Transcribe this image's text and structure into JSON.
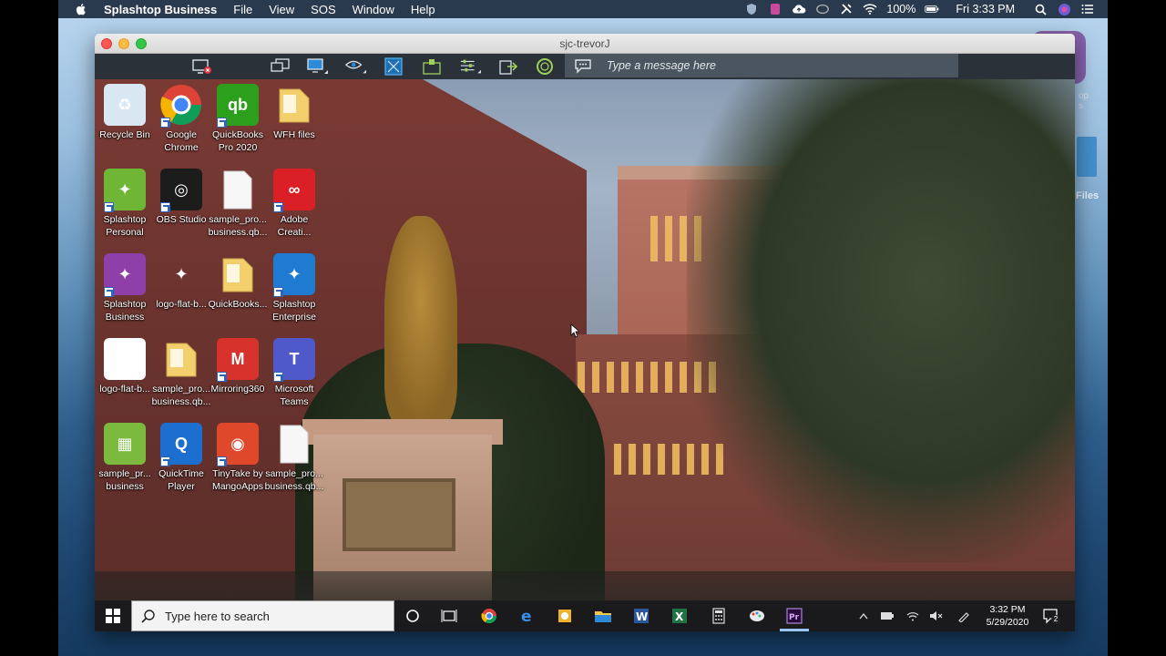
{
  "mac_menubar": {
    "app_name": "Splashtop Business",
    "menus": [
      "File",
      "View",
      "SOS",
      "Window",
      "Help"
    ],
    "battery": "100%",
    "datetime": "Fri 3:33 PM"
  },
  "mac_background": {
    "dock_label_1": "op",
    "dock_label_2": "s",
    "files_label": "Files"
  },
  "window": {
    "title": "sjc-trevorJ",
    "message_placeholder": "Type a message here"
  },
  "desktop_icons": [
    {
      "label1": "Recycle Bin",
      "label2": "",
      "color": "#d8e7f2",
      "glyph": "♻",
      "shortcut": false
    },
    {
      "label1": "Google",
      "label2": "Chrome",
      "color": "#ffffff",
      "glyph": "",
      "shortcut": true
    },
    {
      "label1": "QuickBooks",
      "label2": "Pro 2020",
      "color": "#2ca01c",
      "glyph": "qb",
      "shortcut": true
    },
    {
      "label1": "WFH files",
      "label2": "",
      "color": "#f3d06b",
      "glyph": "",
      "shortcut": false
    },
    {
      "label1": "Splashtop",
      "label2": "Personal",
      "color": "#6fb536",
      "glyph": "✦",
      "shortcut": true
    },
    {
      "label1": "OBS Studio",
      "label2": "",
      "color": "#1c1c1c",
      "glyph": "◎",
      "shortcut": true
    },
    {
      "label1": "sample_pro...",
      "label2": "business.qb...",
      "color": "#f5f5f5",
      "glyph": "",
      "shortcut": false
    },
    {
      "label1": "Adobe",
      "label2": "Creati...",
      "color": "#da1f26",
      "glyph": "∞",
      "shortcut": true
    },
    {
      "label1": "Splashtop",
      "label2": "Business",
      "color": "#8e3fa8",
      "glyph": "✦",
      "shortcut": true
    },
    {
      "label1": "logo-flat-b...",
      "label2": "",
      "color": "transparent",
      "glyph": "✦",
      "shortcut": false
    },
    {
      "label1": "QuickBooks...",
      "label2": "",
      "color": "#f3d06b",
      "glyph": "",
      "shortcut": false
    },
    {
      "label1": "Splashtop",
      "label2": "Enterprise",
      "color": "#1f7bd1",
      "glyph": "✦",
      "shortcut": true
    },
    {
      "label1": "logo-flat-b...",
      "label2": "",
      "color": "#ffffff",
      "glyph": "✦",
      "shortcut": false
    },
    {
      "label1": "sample_pro...",
      "label2": "business.qb...",
      "color": "#f3d06b",
      "glyph": "",
      "shortcut": false
    },
    {
      "label1": "Mirroring360",
      "label2": "",
      "color": "#d8322d",
      "glyph": "M",
      "shortcut": true
    },
    {
      "label1": "Microsoft",
      "label2": "Teams",
      "color": "#5059c9",
      "glyph": "T",
      "shortcut": true
    },
    {
      "label1": "sample_pr...",
      "label2": "business",
      "color": "#7cb93f",
      "glyph": "▦",
      "shortcut": false
    },
    {
      "label1": "QuickTime",
      "label2": "Player",
      "color": "#1d6fcf",
      "glyph": "Q",
      "shortcut": true
    },
    {
      "label1": "TinyTake by",
      "label2": "MangoApps",
      "color": "#e0482c",
      "glyph": "◉",
      "shortcut": true
    },
    {
      "label1": "sample_pro...",
      "label2": "business.qb...",
      "color": "#f5f5f5",
      "glyph": "",
      "shortcut": false
    }
  ],
  "taskbar": {
    "search_placeholder": "Type here to search",
    "time": "3:32 PM",
    "date": "5/29/2020",
    "notifications": "2"
  }
}
